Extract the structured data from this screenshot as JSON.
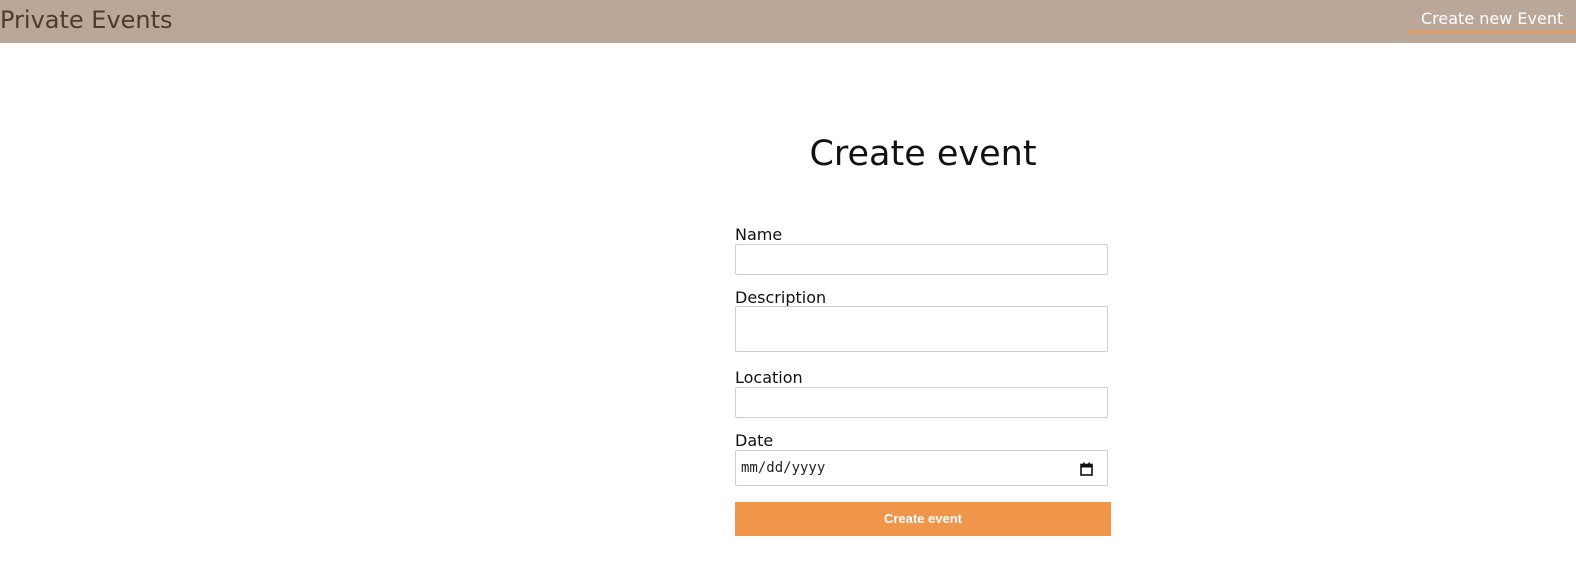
{
  "navbar": {
    "brand": "Private Events",
    "link_label": "Create new Event"
  },
  "page": {
    "title": "Create event"
  },
  "form": {
    "fields": [
      {
        "label": "Name",
        "value": "",
        "placeholder": ""
      },
      {
        "label": "Description",
        "value": "",
        "placeholder": ""
      },
      {
        "label": "Location",
        "value": "",
        "placeholder": ""
      },
      {
        "label": "Date",
        "value": "mm/dd/yyyy",
        "placeholder": ""
      }
    ],
    "submit_label": "Create event"
  },
  "colors": {
    "navbar_bg": "#baa798",
    "brand_text": "#4d3b2f",
    "accent": "#f0964a"
  },
  "icons": {
    "date_field": "calendar-icon"
  }
}
